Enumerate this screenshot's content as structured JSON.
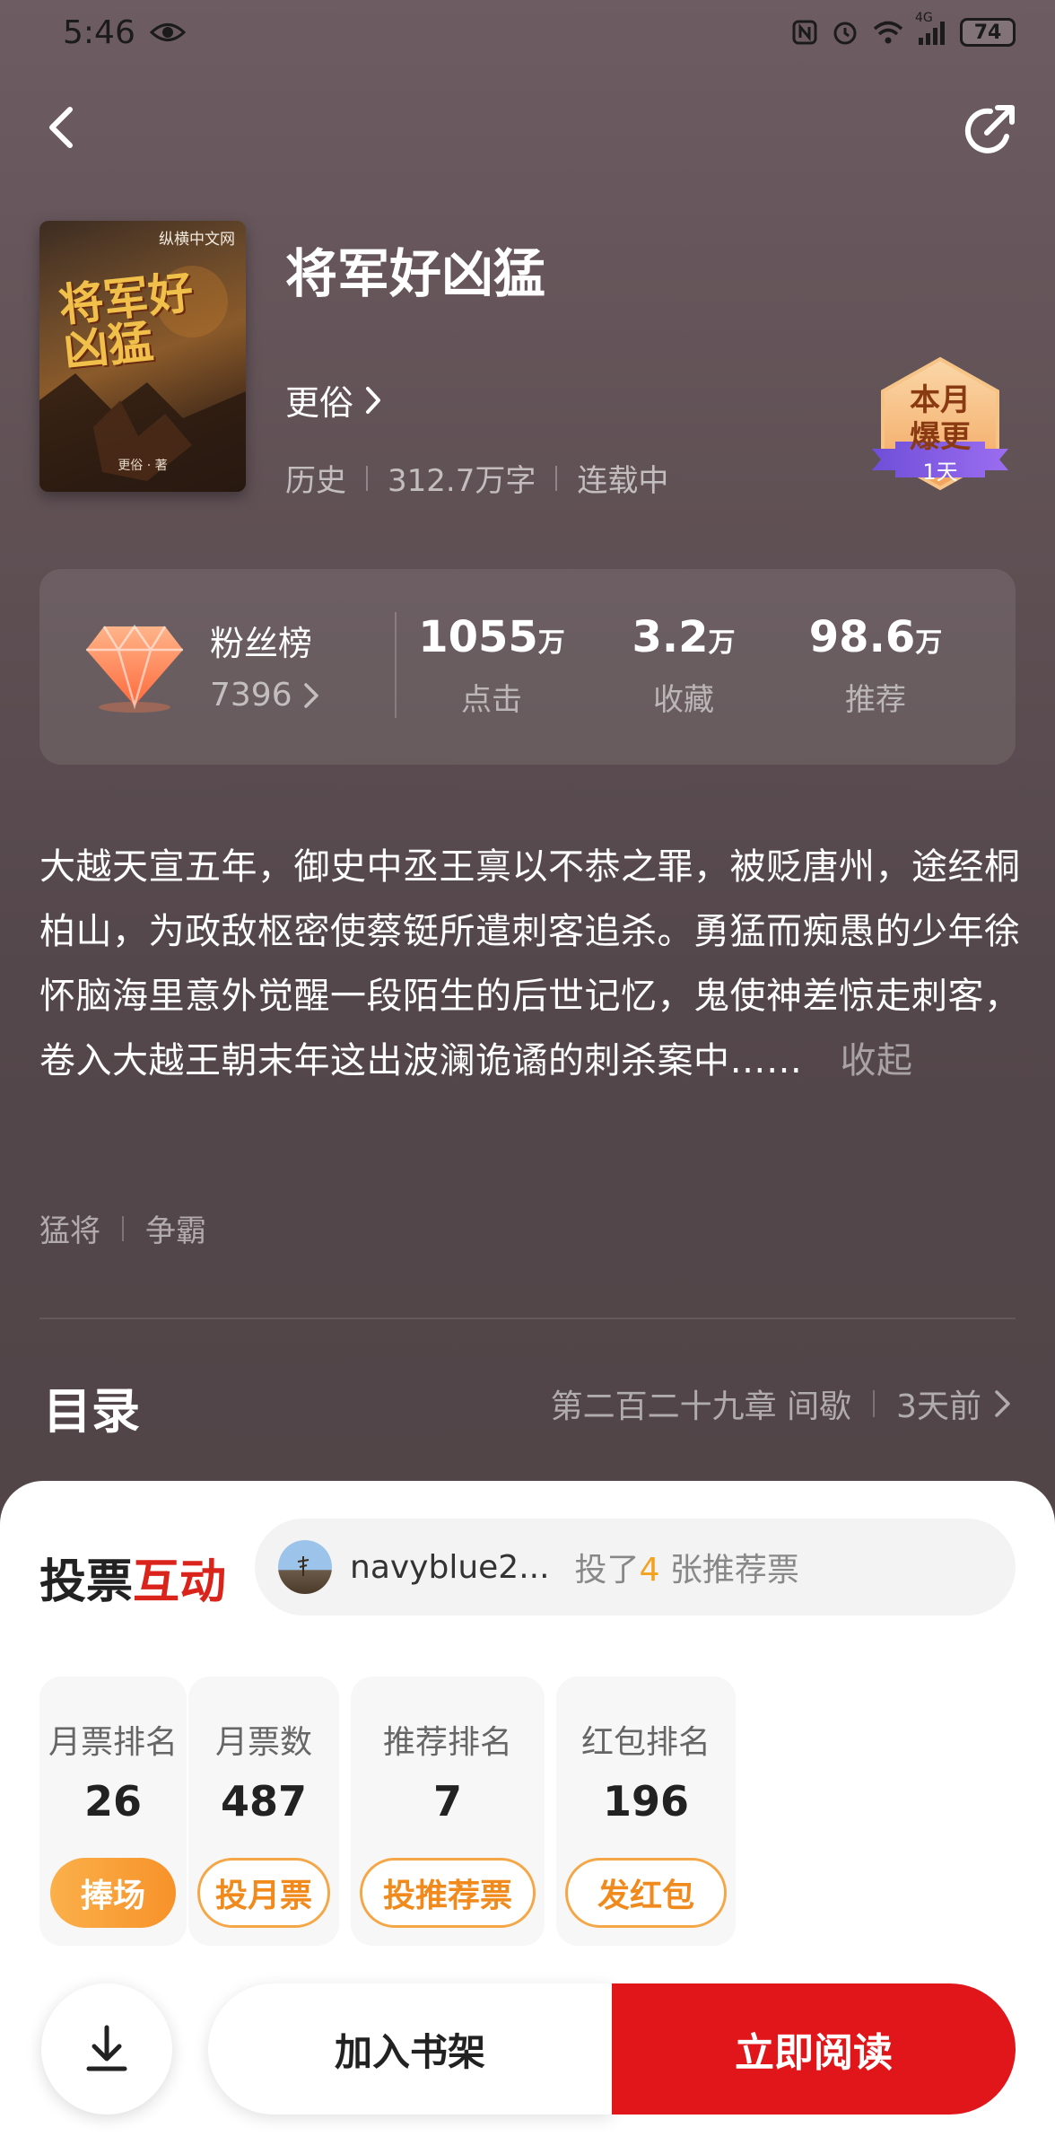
{
  "status_bar": {
    "time": "5:46",
    "battery": "74",
    "network": "4G"
  },
  "nav": {
    "back_icon": "chevron-left-icon",
    "share_icon": "share-icon"
  },
  "book": {
    "title": "将军好凶猛",
    "author": "更俗",
    "genre": "历史",
    "word_count": "312.7万字",
    "status": "连载中",
    "cover": {
      "brand": "纵横中文网",
      "title": "将军好凶猛",
      "author": "更俗 · 著"
    }
  },
  "badge": {
    "line1": "本月",
    "line2": "爆更",
    "days": "1天"
  },
  "stats": {
    "fans_label": "粉丝榜",
    "fans_count": "7396",
    "items": [
      {
        "value": "1055",
        "unit": "万",
        "label": "点击"
      },
      {
        "value": "3.2",
        "unit": "万",
        "label": "收藏"
      },
      {
        "value": "98.6",
        "unit": "万",
        "label": "推荐"
      }
    ]
  },
  "synopsis": {
    "text": "大越天宣五年，御史中丞王禀以不恭之罪，被贬唐州，途经桐柏山，为政敌枢密使蔡铤所遣刺客追杀。勇猛而痴愚的少年徐怀脑海里意外觉醒一段陌生的后世记忆，鬼使神差惊走刺客，卷入大越王朝末年这出波澜诡谲的刺杀案中……",
    "collapse": "收起"
  },
  "tags": [
    "猛将",
    "争霸"
  ],
  "toc": {
    "title": "目录",
    "latest_chapter": "第二百二十九章 间歇",
    "updated": "3天前"
  },
  "vote": {
    "title_a": "投票",
    "title_b": "互动",
    "recent_voter": "navyblue2...",
    "recent_text_prefix": "投了",
    "recent_count": "4",
    "recent_text_suffix": " 张推荐票",
    "cards": [
      {
        "label": "月票排名",
        "value": "26",
        "button": "捧场"
      },
      {
        "label": "月票数",
        "value": "487",
        "button": "投月票"
      },
      {
        "label": "推荐排名",
        "value": "7",
        "button": "投推荐票"
      },
      {
        "label": "红包排名",
        "value": "196",
        "button": "发红包"
      }
    ]
  },
  "actions": {
    "add_shelf": "加入书架",
    "read_now": "立即阅读"
  },
  "colors": {
    "accent_red": "#e0161b",
    "accent_orange": "#f7922a",
    "highlight_yellow": "#f3a21f"
  }
}
